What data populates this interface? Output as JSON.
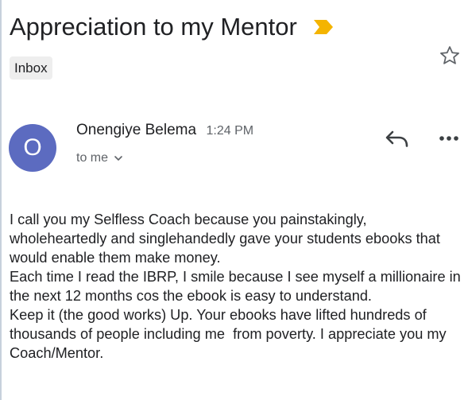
{
  "email": {
    "subject": "Appreciation to my Mentor",
    "label": "Inbox",
    "sender": {
      "initial": "O",
      "name": "Onengiye Belema",
      "time": "1:24 PM",
      "recipient": "to me"
    },
    "body": [
      "I call you my Selfless Coach because you painstakingly, wholeheartedly and singlehandedly gave your students ebooks that would enable them make money.",
      "Each time I read the IBRP, I smile because I see myself a millionaire in the next 12 months cos the ebook is easy to understand.",
      "Keep it (the good works) Up. Your ebooks have lifted hundreds of thousands of people including me  from poverty. I appreciate you my Coach/Mentor."
    ]
  },
  "icons": {
    "importance": "importance-marker-icon",
    "star": "star-outline-icon",
    "recipient_expand": "chevron-down-icon",
    "reply": "reply-icon",
    "more": "more-horizontal-icon"
  },
  "colors": {
    "avatar": "#5c6bc0",
    "importance": "#f4b400",
    "label_chip": "#eeeeee",
    "secondary_text": "#5f6368"
  }
}
